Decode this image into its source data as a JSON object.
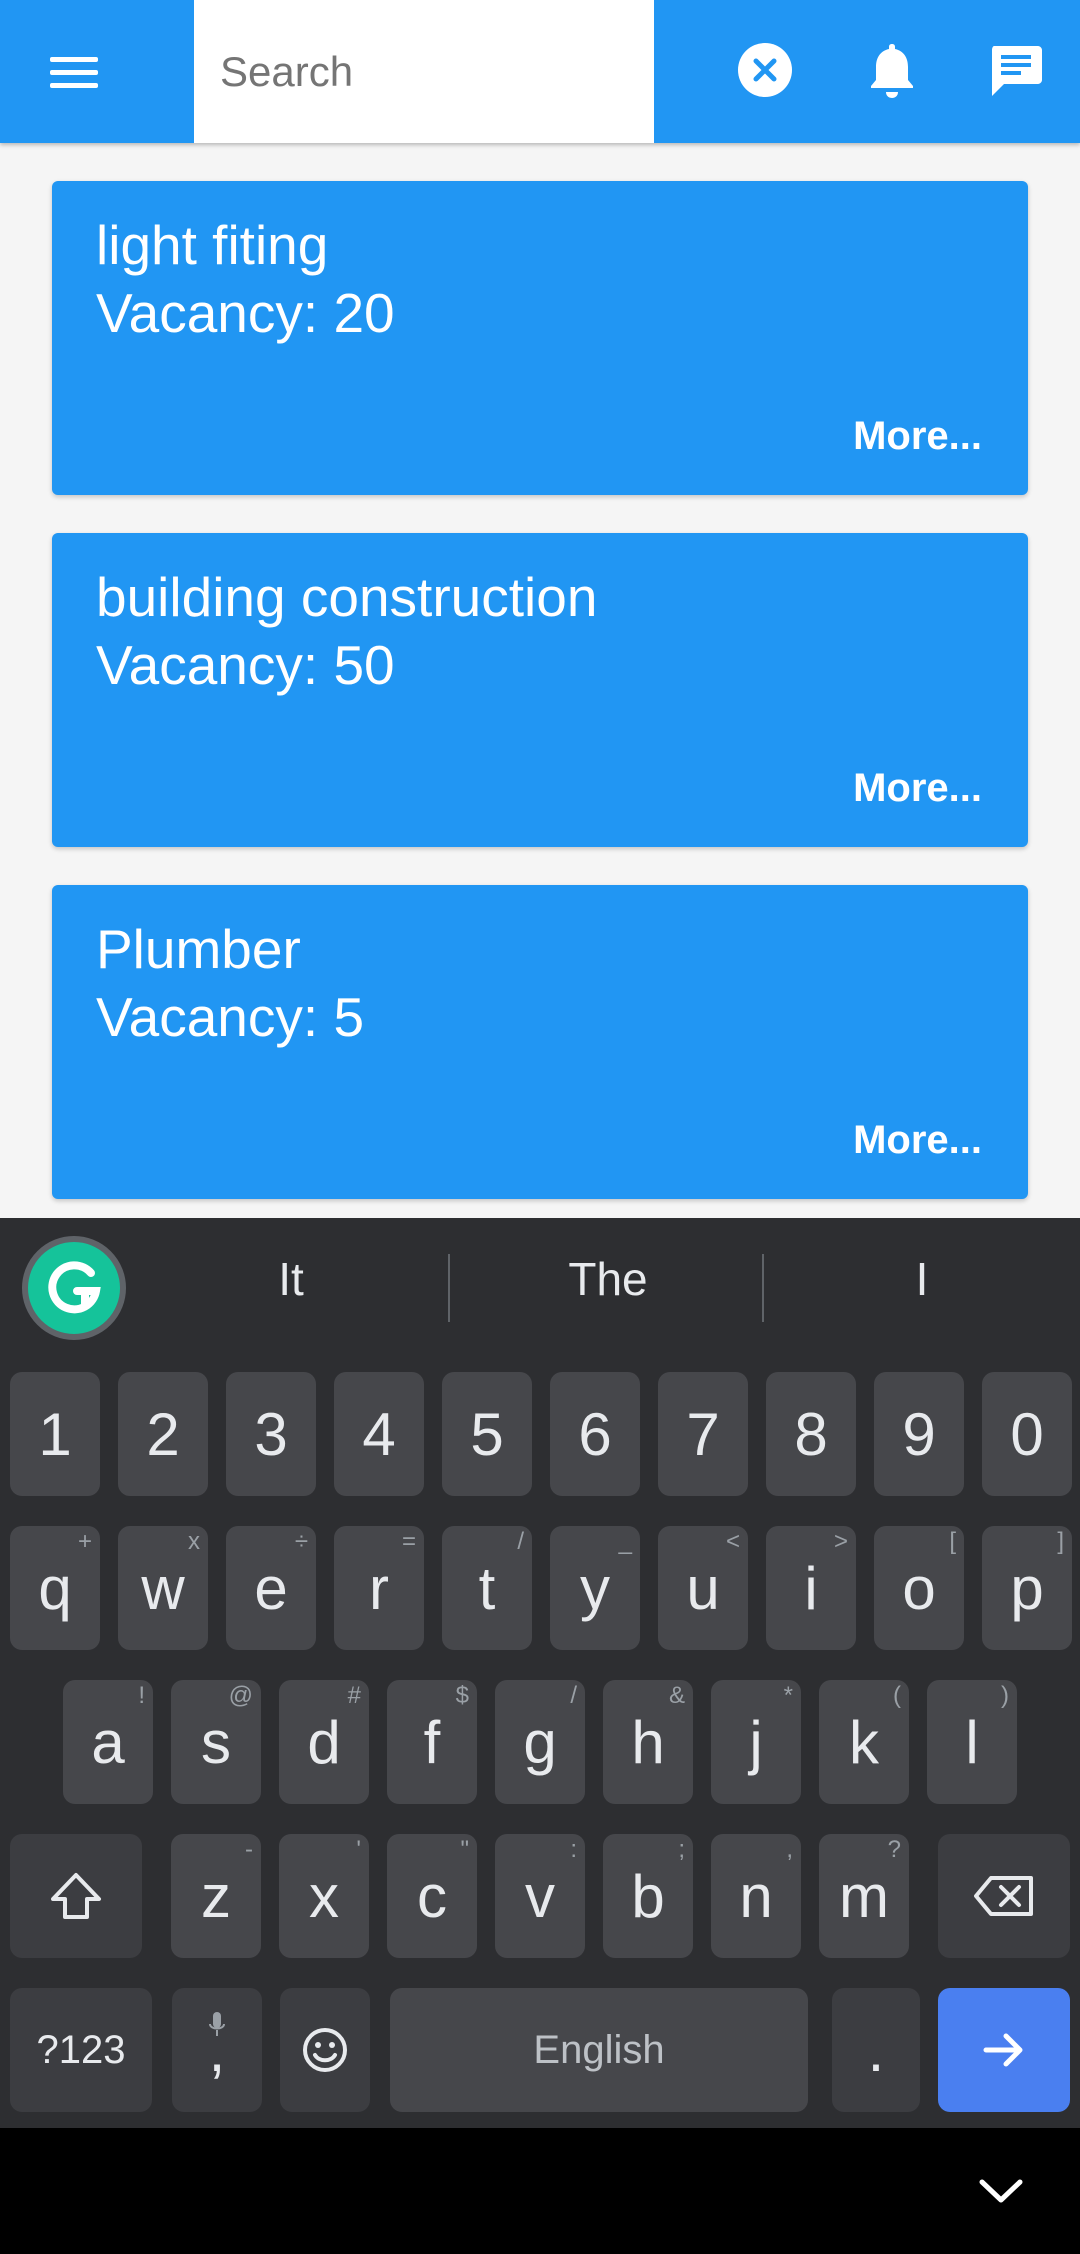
{
  "appbar": {
    "search_placeholder": "Search",
    "icons": [
      "menu-icon",
      "clear-icon",
      "bell-icon",
      "chat-icon"
    ],
    "color": "#2196f3"
  },
  "cards": [
    {
      "title": "light fiting",
      "vacancy_label": "Vacancy: ",
      "vacancy": "20",
      "more": "More..."
    },
    {
      "title": "building construction",
      "vacancy_label": "Vacancy: ",
      "vacancy": "50",
      "more": "More..."
    },
    {
      "title": "Plumber",
      "vacancy_label": "Vacancy: ",
      "vacancy": "5",
      "more": "More..."
    }
  ],
  "keyboard": {
    "suggestions": [
      "It",
      "The",
      "I"
    ],
    "row_numbers": [
      "1",
      "2",
      "3",
      "4",
      "5",
      "6",
      "7",
      "8",
      "9",
      "0"
    ],
    "row_top": [
      {
        "k": "q",
        "h": "+"
      },
      {
        "k": "w",
        "h": "x"
      },
      {
        "k": "e",
        "h": "÷"
      },
      {
        "k": "r",
        "h": "="
      },
      {
        "k": "t",
        "h": "/"
      },
      {
        "k": "y",
        "h": "_"
      },
      {
        "k": "u",
        "h": "<"
      },
      {
        "k": "i",
        "h": ">"
      },
      {
        "k": "o",
        "h": "["
      },
      {
        "k": "p",
        "h": "]"
      }
    ],
    "row_mid": [
      {
        "k": "a",
        "h": "!"
      },
      {
        "k": "s",
        "h": "@"
      },
      {
        "k": "d",
        "h": "#"
      },
      {
        "k": "f",
        "h": "$"
      },
      {
        "k": "g",
        "h": "/"
      },
      {
        "k": "h",
        "h": "&"
      },
      {
        "k": "j",
        "h": "*"
      },
      {
        "k": "k",
        "h": "("
      },
      {
        "k": "l",
        "h": ")"
      }
    ],
    "row_bottom": [
      {
        "k": "z",
        "h": "-"
      },
      {
        "k": "x",
        "h": "'"
      },
      {
        "k": "c",
        "h": "\""
      },
      {
        "k": "v",
        "h": ":"
      },
      {
        "k": "b",
        "h": ";"
      },
      {
        "k": "n",
        "h": ","
      },
      {
        "k": "m",
        "h": "?"
      }
    ],
    "symbols_key": "?123",
    "comma_key": ",",
    "space_label": "English",
    "period_key": "."
  }
}
